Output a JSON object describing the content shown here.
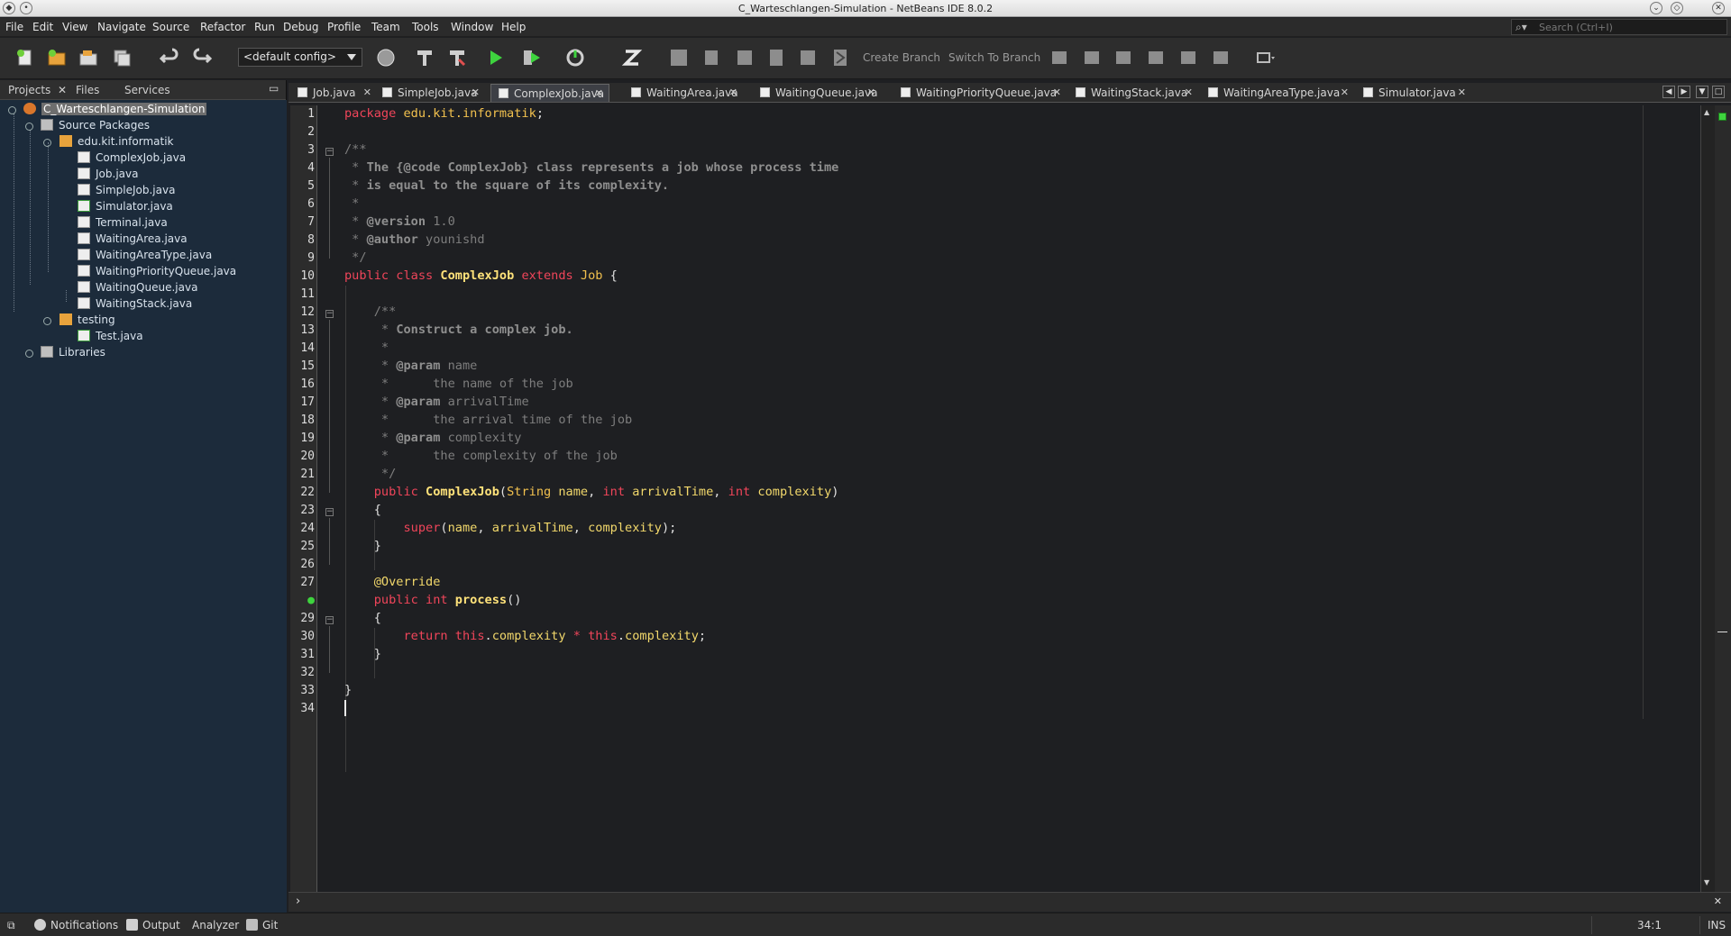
{
  "window": {
    "title": "C_Warteschlangen-Simulation - NetBeans IDE 8.0.2"
  },
  "menu": [
    "File",
    "Edit",
    "View",
    "Navigate",
    "Source",
    "Refactor",
    "Run",
    "Debug",
    "Profile",
    "Team",
    "Tools",
    "Window",
    "Help"
  ],
  "search": {
    "placeholder": "Search (Ctrl+I)"
  },
  "toolbar": {
    "config": "<default config>",
    "create_branch": "Create Branch",
    "switch_branch": "Switch To Branch"
  },
  "project_panel": {
    "tabs": [
      "Projects",
      "Files",
      "Services"
    ],
    "root": "C_Warteschlangen-Simulation",
    "source_packages": "Source Packages",
    "package": "edu.kit.informatik",
    "files": [
      "ComplexJob.java",
      "Job.java",
      "SimpleJob.java",
      "Simulator.java",
      "Terminal.java",
      "WaitingArea.java",
      "WaitingAreaType.java",
      "WaitingPriorityQueue.java",
      "WaitingQueue.java",
      "WaitingStack.java"
    ],
    "testing_package": "testing",
    "testing_files": [
      "Test.java"
    ],
    "libraries": "Libraries"
  },
  "editor": {
    "tabs": [
      "Job.java",
      "SimpleJob.java",
      "ComplexJob.java",
      "WaitingArea.java",
      "WaitingQueue.java",
      "WaitingPriorityQueue.java",
      "WaitingStack.java",
      "WaitingAreaType.java",
      "Simulator.java"
    ],
    "active_tab": "ComplexJob.java",
    "line_numbers": [
      "1",
      "2",
      "3",
      "4",
      "5",
      "6",
      "7",
      "8",
      "9",
      "10",
      "11",
      "12",
      "13",
      "14",
      "15",
      "16",
      "17",
      "18",
      "19",
      "20",
      "21",
      "22",
      "23",
      "24",
      "25",
      "26",
      "27",
      "",
      "29",
      "30",
      "31",
      "32",
      "33",
      "34"
    ]
  },
  "status": {
    "notifications": "Notifications",
    "output": "Output",
    "analyzer": "Analyzer",
    "git": "Git",
    "position": "34:1",
    "mode": "INS"
  },
  "colors": {
    "keyword": "#f0455a",
    "type": "#f2c14e",
    "comment": "#7e7e7e",
    "background": "#1e1f22"
  }
}
